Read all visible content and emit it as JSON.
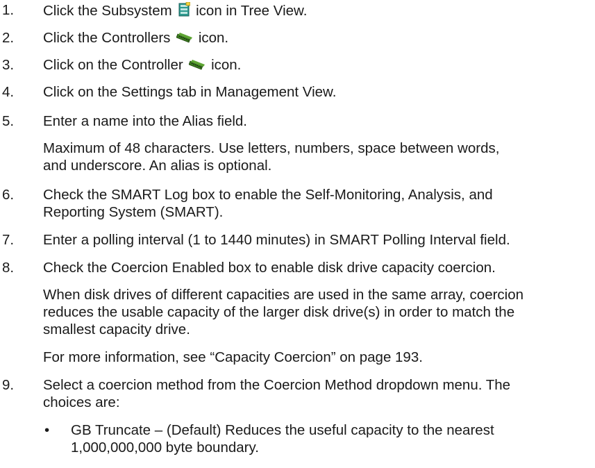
{
  "steps": [
    {
      "num": "1.",
      "pre": "Click the Subsystem",
      "icon": "subsystem-icon",
      "post": "icon in Tree View."
    },
    {
      "num": "2.",
      "pre": "Click the Controllers",
      "icon": "controllers-icon",
      "post": "icon."
    },
    {
      "num": "3.",
      "pre": "Click on the Controller",
      "icon": "controller-icon",
      "post": "icon."
    },
    {
      "num": "4.",
      "text": "Click on the Settings tab in Management View."
    },
    {
      "num": "5.",
      "text": "Enter a name into the Alias field.",
      "note": [
        "Maximum of 48 characters. Use letters, numbers, space between words,",
        "and underscore. An alias is optional."
      ]
    },
    {
      "num": "6.",
      "text": [
        "Check the SMART Log box to enable the Self-Monitoring, Analysis, and",
        "Reporting System (SMART)."
      ]
    },
    {
      "num": "7.",
      "text": "Enter a polling interval (1 to 1440 minutes) in SMART Polling Interval field."
    },
    {
      "num": "8.",
      "text": "Check the Coercion Enabled box to enable disk drive capacity coercion.",
      "note": [
        "When disk drives of different capacities are used in the same array, coercion",
        "reduces the usable capacity of the larger disk drive(s) in order to match the",
        "smallest capacity drive."
      ],
      "note2": "For more information, see “Capacity Coercion” on page 193."
    },
    {
      "num": "9.",
      "text": [
        "Select a coercion method from the Coercion Method dropdown menu. The",
        "choices are:"
      ],
      "bullets": [
        {
          "symbol": "•",
          "lines": [
            "GB Truncate – (Default) Reduces the useful capacity to the nearest",
            "1,000,000,000 byte boundary."
          ]
        }
      ]
    }
  ],
  "colors": {
    "subsystem_icon": "#2e9a8f",
    "controller_icon": "#3a7a1e"
  }
}
